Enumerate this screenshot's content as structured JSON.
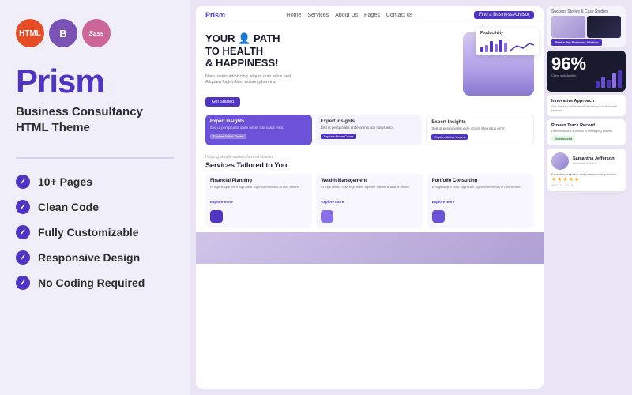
{
  "left": {
    "badges": [
      {
        "label": "HTML",
        "class": "badge-html"
      },
      {
        "label": "B",
        "class": "badge-bs"
      },
      {
        "label": "Sass",
        "class": "badge-sass"
      }
    ],
    "brand": "Prism",
    "subtitle_line1": "Business Consultancy",
    "subtitle_line2": "HTML Theme",
    "features": [
      {
        "label": "10+ Pages"
      },
      {
        "label": "Clean Code"
      },
      {
        "label": "Fully Customizable"
      },
      {
        "label": "Responsive Design"
      },
      {
        "label": "No Coding Required"
      }
    ]
  },
  "preview": {
    "navbar": {
      "logo": "Prism",
      "links": [
        "Home",
        "Services",
        "About Us",
        "Pages",
        "Contact us"
      ],
      "btn": "Find a Business Advisor"
    },
    "hero": {
      "title_line1": "YOUR",
      "title_line2": "PATH",
      "title_line3": "TO HEALTH",
      "title_line4": "& HAPPINESS!",
      "desc": "Nam varius adipiscing aliquet quis tellus sed. Aliquam fugiat diam nullam pharetra.",
      "btn": "Get Started"
    },
    "productivity": "Productivity",
    "cards": [
      {
        "type": "purple",
        "title": "Expert Insights",
        "desc": "Sed ut perspiciatis unde omnis iste natus error.",
        "btn": "Explore Active Cases"
      },
      {
        "type": "light",
        "title": "Expert Insights",
        "desc": "Sed ut perspiciatis unde omnis iste natus error.",
        "btn": "Explore Active Cases"
      },
      {
        "type": "white",
        "title": "Expert Insights",
        "desc": "Sed ut perspiciatis unde omnis iste natus error.",
        "btn": "Explore Active Cases"
      }
    ],
    "services": {
      "label": "Helping people make informed choices",
      "title": "Services Tailored to You",
      "items": [
        {
          "name": "Financial Planning",
          "desc": "Et fugit libique volut fugit diam. Agentur maximus at duis ornare."
        },
        {
          "name": "Wealth Management",
          "desc": "Et fugit libique volut fugit diam. Agentur maximus at duis ornare."
        },
        {
          "name": "Portfolio Consulting",
          "desc": "Et fugit libique volut fugit diam. Agentur maximus at duis ornare."
        }
      ]
    }
  },
  "side": {
    "top_label": "Success Stories & Case Studies",
    "find_btn": "Find a Pro Business Advisor",
    "stat": "96%",
    "stat_label": "Client satisfaction",
    "innovative": {
      "title": "Innovative Approach",
      "desc": "Our friendly Advisors will Assist you in financial choices."
    },
    "track": {
      "title": "Proven Track Record",
      "desc": "Demonstrated success in managing billions.",
      "tag": "Guaranteed"
    },
    "person": {
      "name": "Samantha Jefferson",
      "role": "Financial Advisor",
      "review": "Exceptional service and professional guidance.",
      "stars": "★★★★★",
      "meta": "ARC7C - G2134"
    }
  }
}
